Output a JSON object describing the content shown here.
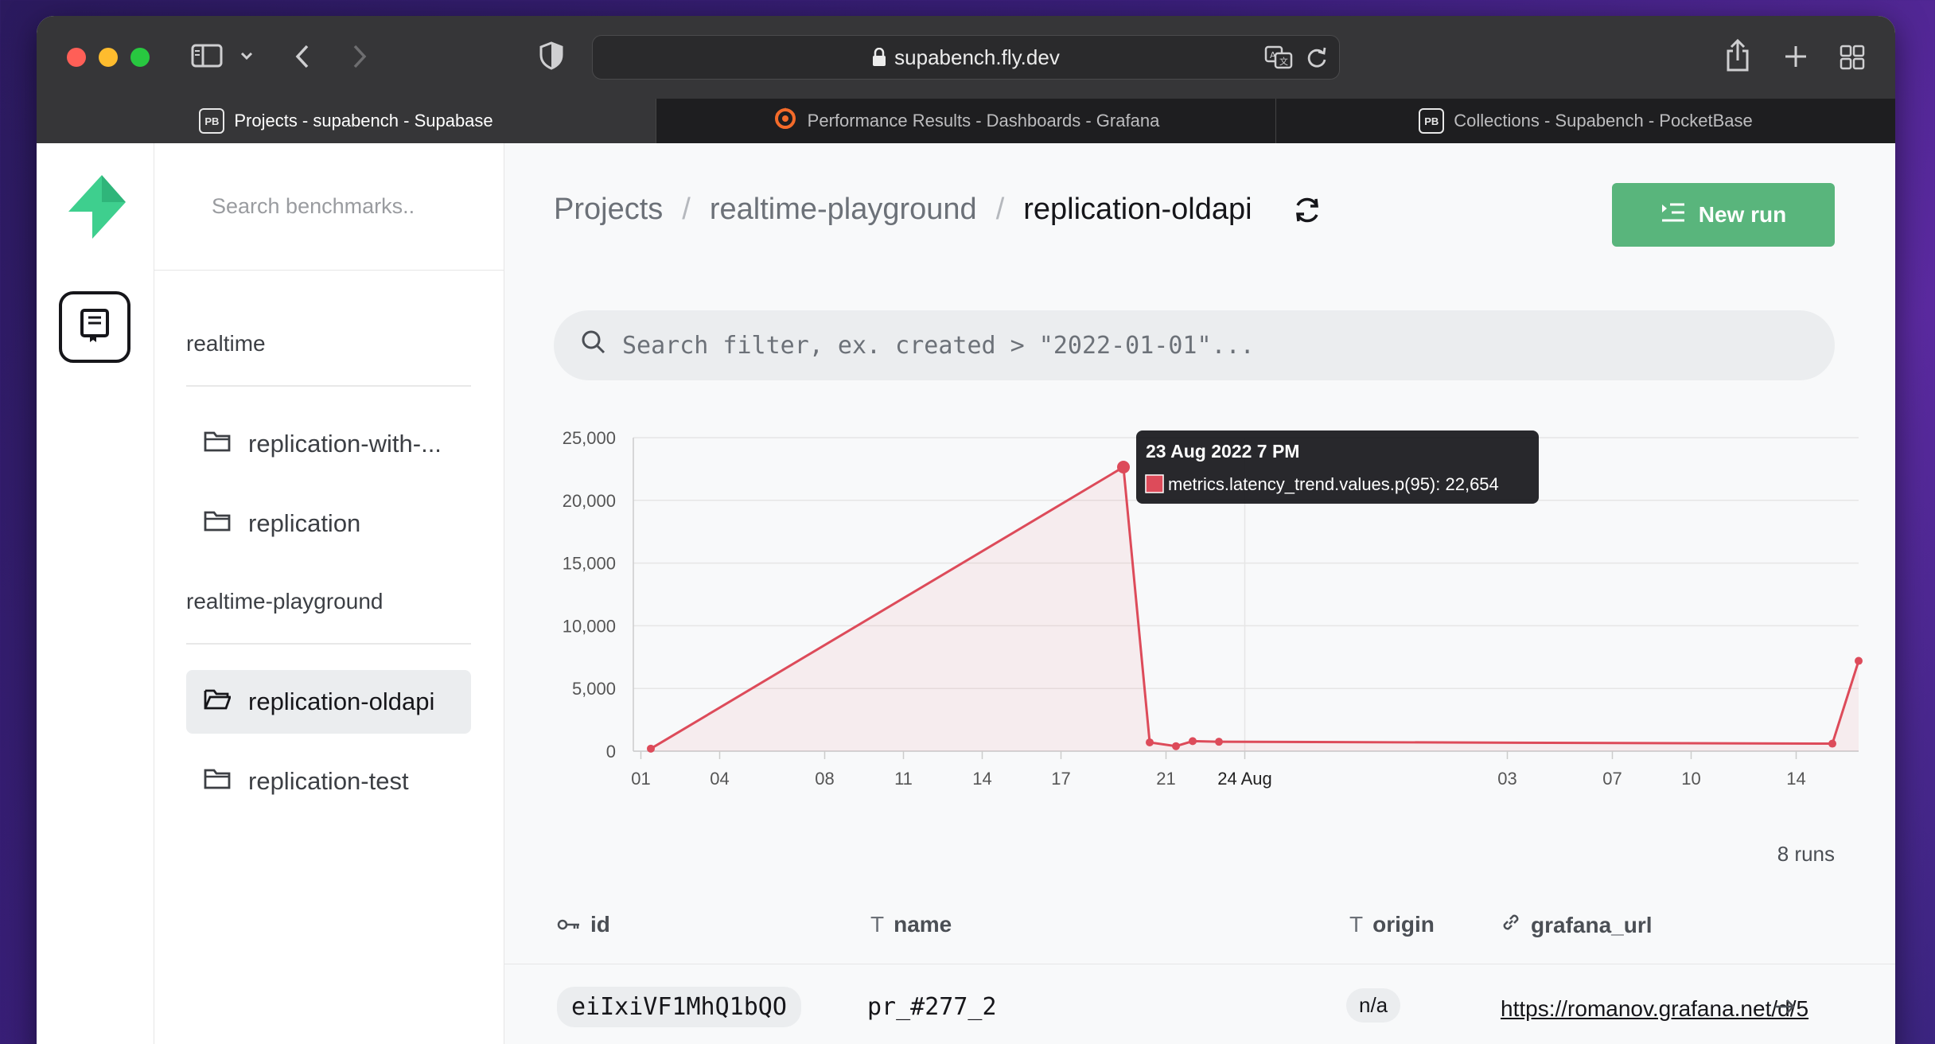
{
  "browser": {
    "url": "supabench.fly.dev",
    "tabs": [
      {
        "label": "Projects - supabench - Supabase",
        "active": true
      },
      {
        "label": "Performance Results - Dashboards - Grafana",
        "active": false
      },
      {
        "label": "Collections - Supabench - PocketBase",
        "active": false
      }
    ]
  },
  "sidebar": {
    "search_placeholder": "Search benchmarks..",
    "groups": [
      {
        "label": "realtime",
        "items": [
          {
            "label": "replication-with-..."
          },
          {
            "label": "replication"
          }
        ]
      },
      {
        "label": "realtime-playground",
        "items": [
          {
            "label": "replication-oldapi",
            "active": true
          },
          {
            "label": "replication-test"
          }
        ]
      }
    ]
  },
  "main": {
    "breadcrumb": [
      "Projects",
      "realtime-playground",
      "replication-oldapi"
    ],
    "new_run_label": "New run",
    "filter_placeholder": "Search filter, ex. created > \"2022-01-01\"...",
    "runs_count": "8 runs",
    "table": {
      "columns": [
        {
          "label": "id",
          "icon": "key-icon"
        },
        {
          "label": "name",
          "icon": "text-type-icon"
        },
        {
          "label": "origin",
          "icon": "text-type-icon"
        },
        {
          "label": "grafana_url",
          "icon": "link-icon"
        }
      ],
      "rows": [
        {
          "id": "eiIxiVF1MhQ1bQO",
          "name": "pr_#277_2",
          "origin": "n/a",
          "grafana_url": "https://romanov.grafana.net/d/5"
        }
      ]
    }
  },
  "chart_data": {
    "type": "area",
    "color": "#dd4b5a",
    "x_tick_labels": [
      "01",
      "04",
      "08",
      "11",
      "14",
      "17",
      "21",
      "24 Aug",
      "03",
      "07",
      "10",
      "14"
    ],
    "y_tick_labels": [
      "0",
      "5,000",
      "10,000",
      "15,000",
      "20,000",
      "25,000"
    ],
    "ylim": [
      0,
      25000
    ],
    "series": [
      {
        "name": "metrics.latency_trend.values.p(95)",
        "points": [
          {
            "x": "2022-08-01",
            "y": 200
          },
          {
            "x": "2022-08-19",
            "y": 22654
          },
          {
            "x": "2022-08-20",
            "y": 700
          },
          {
            "x": "2022-08-21",
            "y": 400
          },
          {
            "x": "2022-08-22",
            "y": 800
          },
          {
            "x": "2022-08-22",
            "y": 750
          },
          {
            "x": "2022-09-15",
            "y": 600
          },
          {
            "x": "2022-09-16",
            "y": 7200
          }
        ]
      }
    ],
    "tooltip": {
      "title": "23 Aug 2022 7 PM",
      "label": "metrics.latency_trend.values.p(95): 22,654"
    }
  }
}
